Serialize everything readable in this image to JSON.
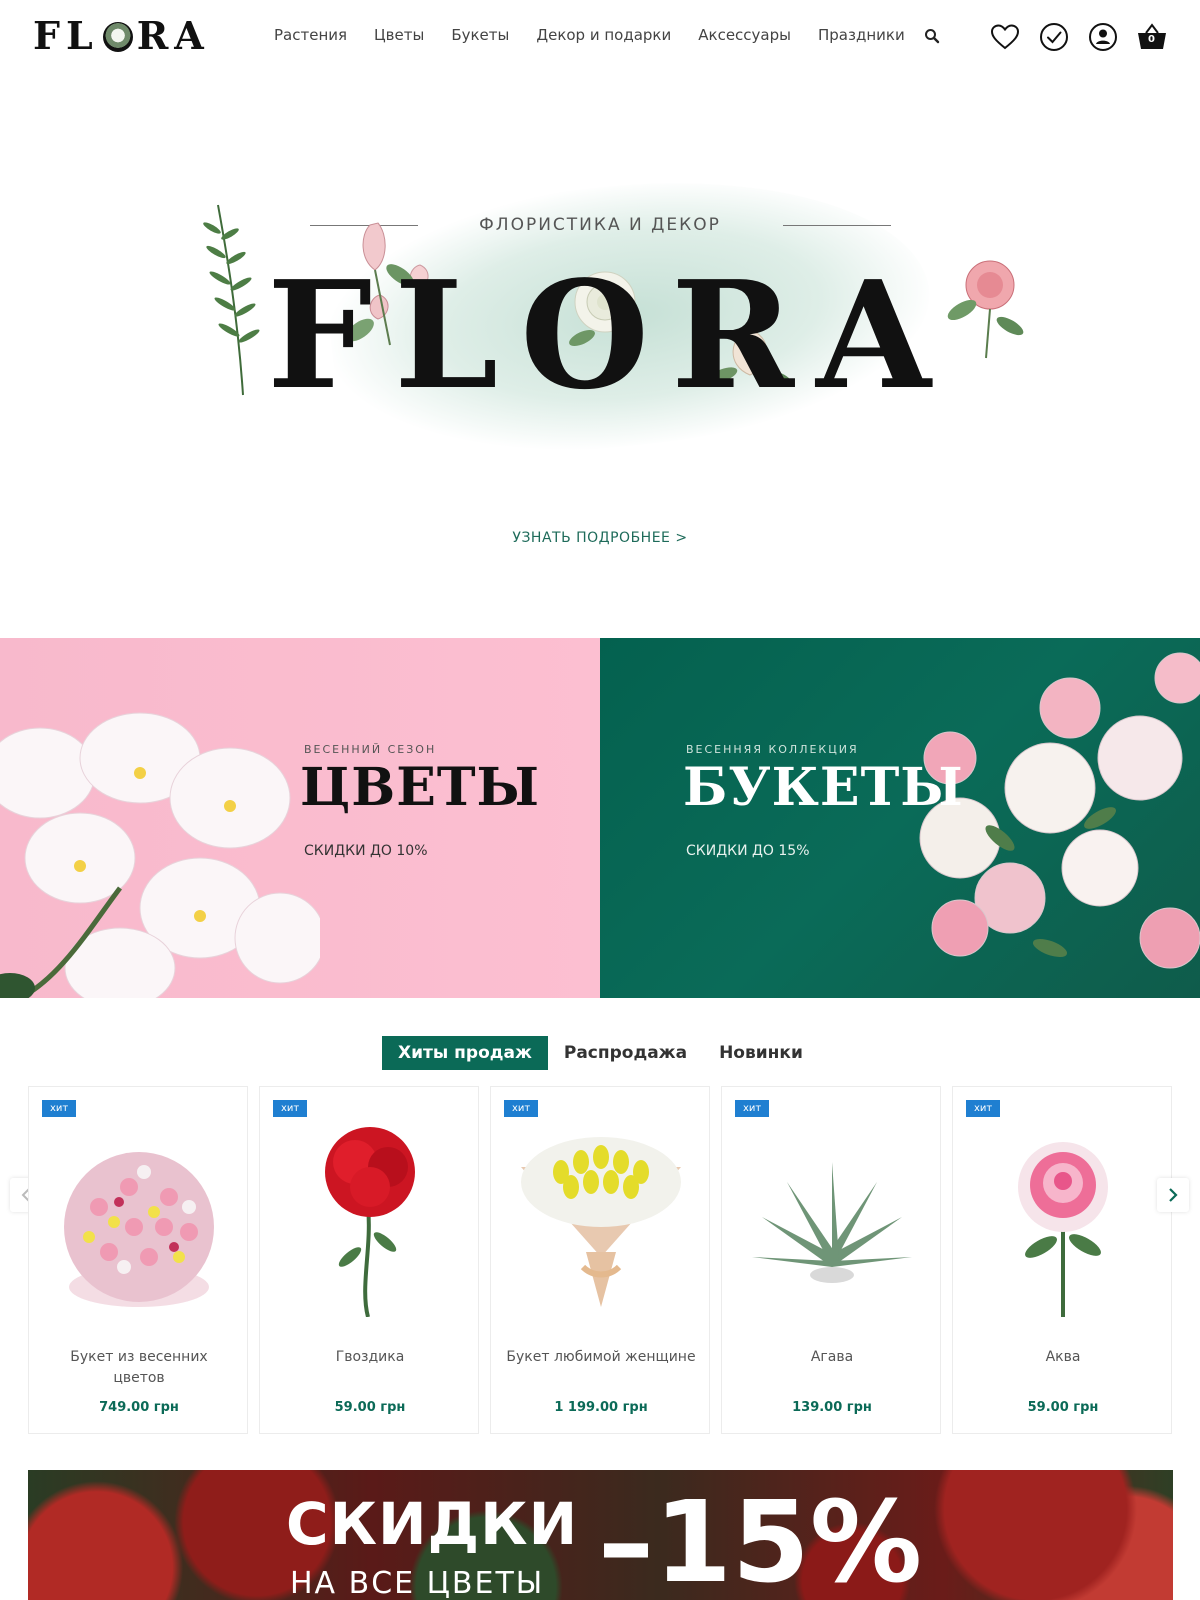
{
  "header": {
    "logo": "FLORA",
    "nav": [
      "Растения",
      "Цветы",
      "Букеты",
      "Декор и подарки",
      "Аксессуары",
      "Праздники"
    ],
    "icons": [
      "search-icon",
      "heart-icon",
      "check-circle-icon",
      "user-icon",
      "basket-icon"
    ],
    "cart_count": "0"
  },
  "hero": {
    "tagline": "флористика и декор",
    "word": "FLORA",
    "more_link": "узнать подробнее  >"
  },
  "promos": {
    "left": {
      "kicker": "весенний сезон",
      "title": "ЦВЕТЫ",
      "subtitle": "скидки до 10%"
    },
    "right": {
      "kicker": "весенняя коллекция",
      "title": "БУКЕТЫ",
      "subtitle": "скидки до 15%"
    }
  },
  "tabs": [
    "Хиты продаж",
    "Распродажа",
    "Новинки"
  ],
  "products": [
    {
      "badge": "хит",
      "name": "Букет из весенних цветов",
      "price": "749.00 грн"
    },
    {
      "badge": "хит",
      "name": "Гвоздика",
      "price": "59.00 грн"
    },
    {
      "badge": "хит",
      "name": "Букет любимой женщине",
      "price": "1 199.00 грн"
    },
    {
      "badge": "хит",
      "name": "Агава",
      "price": "139.00 грн"
    },
    {
      "badge": "хит",
      "name": "Аква",
      "price": "59.00 грн"
    }
  ],
  "sale_banner": {
    "word": "СКИДКИ",
    "subtitle": "на все цветы",
    "percent": "–15%"
  },
  "colors": {
    "accent": "#0b6a57",
    "badge": "#1f7fd1",
    "promo_pink": "#fcbfd1",
    "promo_green": "#04614f"
  }
}
